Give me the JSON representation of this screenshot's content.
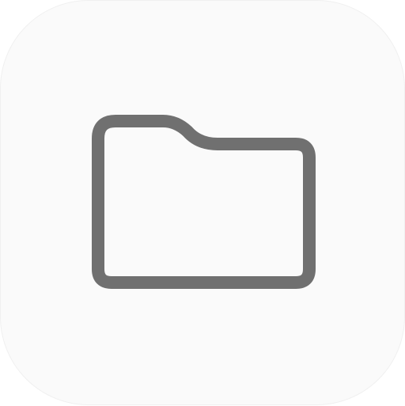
{
  "app_icon": {
    "icon": "folder-icon",
    "background_color": "#fafafa",
    "stroke_color": "#707070"
  }
}
